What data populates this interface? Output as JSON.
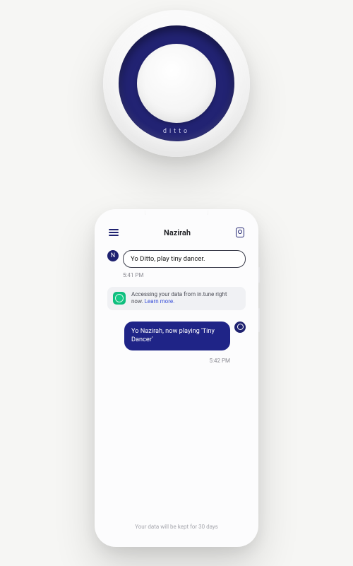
{
  "device": {
    "brand": "ditto"
  },
  "app": {
    "header_name": "Nazirah",
    "user_avatar_initial": "N",
    "user_message": "Yo Ditto, play tiny dancer.",
    "user_timestamp": "5:41 PM",
    "privacy_notice_pre": "Accessing your data from in.tune right now. ",
    "privacy_notice_link": "Learn more.",
    "bot_reply": "Yo Nazirah, now playing 'Tiny Dancer'",
    "bot_timestamp": "5:42 PM",
    "retention_footer": "Your data will be kept for 30 days"
  }
}
